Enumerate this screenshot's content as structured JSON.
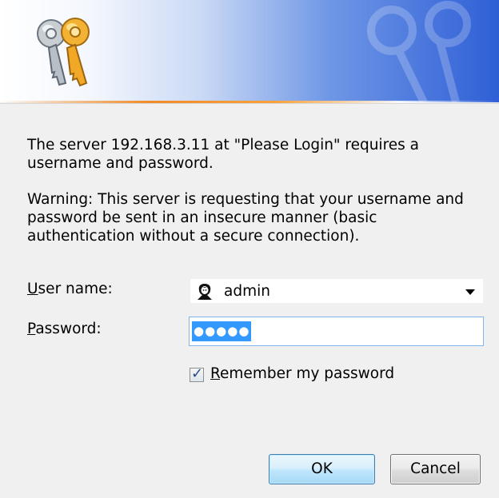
{
  "banner": {
    "icon": "keys-icon"
  },
  "message": {
    "server_line": "The server 192.168.3.11 at \"Please Login\" requires a username and password.",
    "warning": "Warning: This server is requesting that your username and password be sent in an insecure manner (basic authentication without a secure connection)."
  },
  "form": {
    "username_label_key": "U",
    "username_label_rest": "ser name:",
    "username_value": "admin",
    "username_icon": "user-icon",
    "password_label_key": "P",
    "password_label_rest": "assword:",
    "password_masked": "●●●●●",
    "remember_key": "R",
    "remember_rest": "emember my password",
    "remember_checked": true
  },
  "buttons": {
    "ok": "OK",
    "cancel": "Cancel"
  },
  "colors": {
    "accent_blue": "#2f5fd6",
    "banner_rule": "#f28b25",
    "selection": "#3399ff"
  }
}
